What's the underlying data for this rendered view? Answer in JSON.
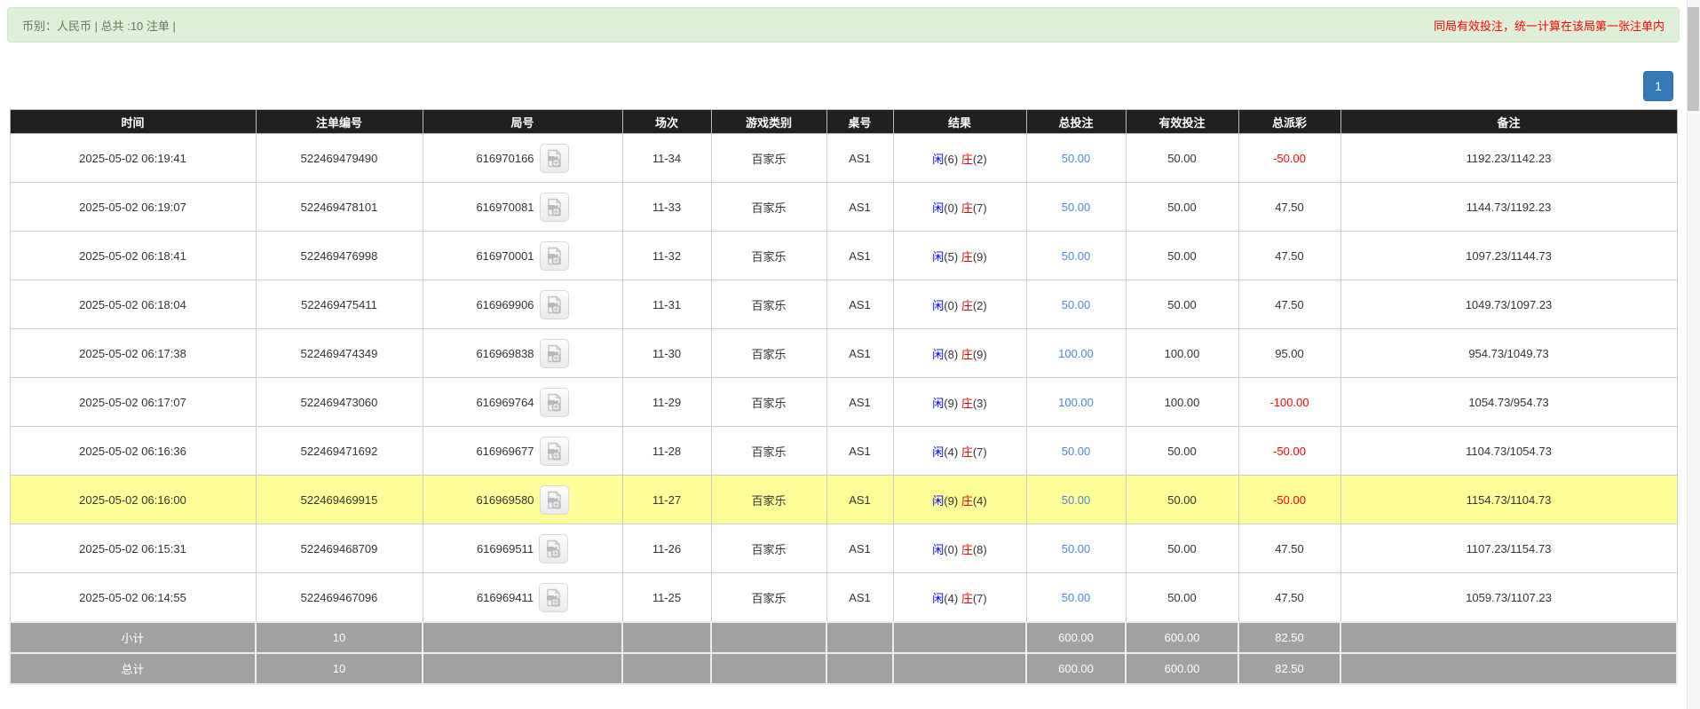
{
  "alert": {
    "left_text": "币别：人民币 | 总共 :10 注单 |",
    "right_text": "同局有效投注，统一计算在该局第一张注单内"
  },
  "pagination": {
    "current_page": "1"
  },
  "colors": {
    "alert_bg": "#dff0d8",
    "alert_warning_text": "#ff0000",
    "header_bg": "#202020",
    "highlight_row": "#ffff99",
    "footer_bg": "#a1a1a1",
    "player_blue": "#0000ee",
    "banker_red": "#ee0000",
    "bet_link_blue": "#4a86e8",
    "negative_red": "#ff0000",
    "pagination_blue": "#337ab7"
  },
  "table": {
    "headers": [
      "时间",
      "注单编号",
      "局号",
      "场次",
      "游戏类别",
      "桌号",
      "结果",
      "总投注",
      "有效投注",
      "总派彩",
      "备注"
    ],
    "rows": [
      {
        "time": "2025-05-02 06:19:41",
        "bet_id": "522469479490",
        "round_id": "616970166",
        "session": "11-34",
        "game": "百家乐",
        "table": "AS1",
        "player": "闲",
        "player_score": "(6)",
        "banker": "庄",
        "banker_score": "(2)",
        "total_bet": "50.00",
        "valid_bet": "50.00",
        "payout": "-50.00",
        "remark": "1192.23/1142.23",
        "highlight": false
      },
      {
        "time": "2025-05-02 06:19:07",
        "bet_id": "522469478101",
        "round_id": "616970081",
        "session": "11-33",
        "game": "百家乐",
        "table": "AS1",
        "player": "闲",
        "player_score": "(0)",
        "banker": "庄",
        "banker_score": "(7)",
        "total_bet": "50.00",
        "valid_bet": "50.00",
        "payout": "47.50",
        "remark": "1144.73/1192.23",
        "highlight": false
      },
      {
        "time": "2025-05-02 06:18:41",
        "bet_id": "522469476998",
        "round_id": "616970001",
        "session": "11-32",
        "game": "百家乐",
        "table": "AS1",
        "player": "闲",
        "player_score": "(5)",
        "banker": "庄",
        "banker_score": "(9)",
        "total_bet": "50.00",
        "valid_bet": "50.00",
        "payout": "47.50",
        "remark": "1097.23/1144.73",
        "highlight": false
      },
      {
        "time": "2025-05-02 06:18:04",
        "bet_id": "522469475411",
        "round_id": "616969906",
        "session": "11-31",
        "game": "百家乐",
        "table": "AS1",
        "player": "闲",
        "player_score": "(0)",
        "banker": "庄",
        "banker_score": "(2)",
        "total_bet": "50.00",
        "valid_bet": "50.00",
        "payout": "47.50",
        "remark": "1049.73/1097.23",
        "highlight": false
      },
      {
        "time": "2025-05-02 06:17:38",
        "bet_id": "522469474349",
        "round_id": "616969838",
        "session": "11-30",
        "game": "百家乐",
        "table": "AS1",
        "player": "闲",
        "player_score": "(8)",
        "banker": "庄",
        "banker_score": "(9)",
        "total_bet": "100.00",
        "valid_bet": "100.00",
        "payout": "95.00",
        "remark": "954.73/1049.73",
        "highlight": false
      },
      {
        "time": "2025-05-02 06:17:07",
        "bet_id": "522469473060",
        "round_id": "616969764",
        "session": "11-29",
        "game": "百家乐",
        "table": "AS1",
        "player": "闲",
        "player_score": "(9)",
        "banker": "庄",
        "banker_score": "(3)",
        "total_bet": "100.00",
        "valid_bet": "100.00",
        "payout": "-100.00",
        "remark": "1054.73/954.73",
        "highlight": false
      },
      {
        "time": "2025-05-02 06:16:36",
        "bet_id": "522469471692",
        "round_id": "616969677",
        "session": "11-28",
        "game": "百家乐",
        "table": "AS1",
        "player": "闲",
        "player_score": "(4)",
        "banker": "庄",
        "banker_score": "(7)",
        "total_bet": "50.00",
        "valid_bet": "50.00",
        "payout": "-50.00",
        "remark": "1104.73/1054.73",
        "highlight": false
      },
      {
        "time": "2025-05-02 06:16:00",
        "bet_id": "522469469915",
        "round_id": "616969580",
        "session": "11-27",
        "game": "百家乐",
        "table": "AS1",
        "player": "闲",
        "player_score": "(9)",
        "banker": "庄",
        "banker_score": "(4)",
        "total_bet": "50.00",
        "valid_bet": "50.00",
        "payout": "-50.00",
        "remark": "1154.73/1104.73",
        "highlight": true
      },
      {
        "time": "2025-05-02 06:15:31",
        "bet_id": "522469468709",
        "round_id": "616969511",
        "session": "11-26",
        "game": "百家乐",
        "table": "AS1",
        "player": "闲",
        "player_score": "(0)",
        "banker": "庄",
        "banker_score": "(8)",
        "total_bet": "50.00",
        "valid_bet": "50.00",
        "payout": "47.50",
        "remark": "1107.23/1154.73",
        "highlight": false
      },
      {
        "time": "2025-05-02 06:14:55",
        "bet_id": "522469467096",
        "round_id": "616969411",
        "session": "11-25",
        "game": "百家乐",
        "table": "AS1",
        "player": "闲",
        "player_score": "(4)",
        "banker": "庄",
        "banker_score": "(7)",
        "total_bet": "50.00",
        "valid_bet": "50.00",
        "payout": "47.50",
        "remark": "1059.73/1107.23",
        "highlight": false
      }
    ],
    "footer": [
      {
        "label": "小计",
        "count": "10",
        "total_bet": "600.00",
        "valid_bet": "600.00",
        "payout": "82.50"
      },
      {
        "label": "总计",
        "count": "10",
        "total_bet": "600.00",
        "valid_bet": "600.00",
        "payout": "82.50"
      }
    ]
  }
}
